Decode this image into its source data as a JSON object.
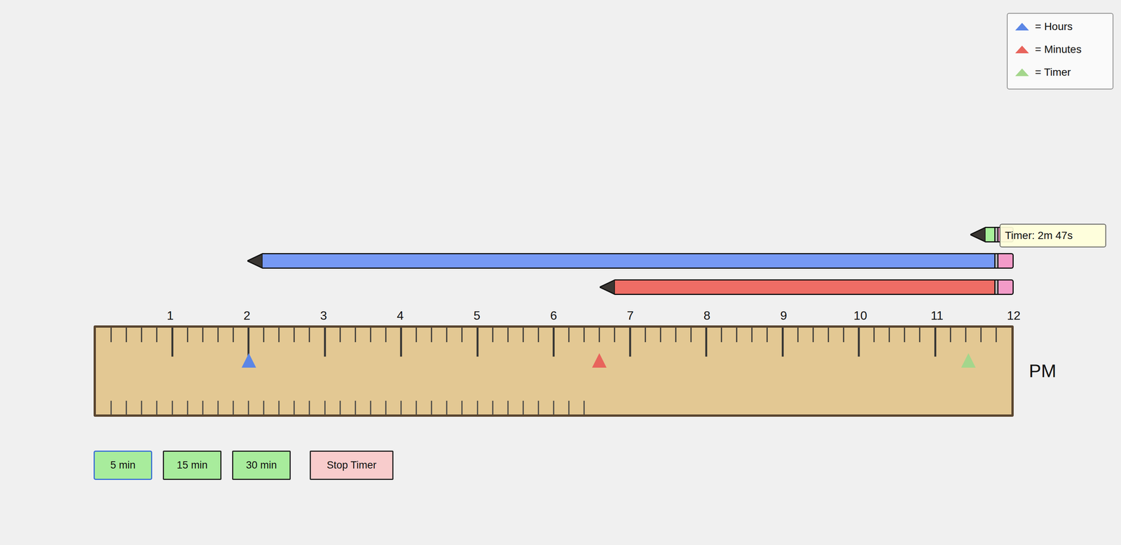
{
  "legend": [
    {
      "label": "= Hours",
      "color": "#5b86e6"
    },
    {
      "label": "= Minutes",
      "color": "#e8645c"
    },
    {
      "label": "= Timer",
      "color": "#a4d68c"
    }
  ],
  "pencils": [
    {
      "level": 0.953,
      "color": "#a8f09a",
      "tooltip": "Timer: 2m 47s"
    },
    {
      "level": 0.167,
      "color": "#7699f4"
    },
    {
      "level": 0.55,
      "color": "#ee6d65"
    }
  ],
  "ruler": {
    "labels": [
      "1",
      "2",
      "3",
      "4",
      "5",
      "6",
      "7",
      "8",
      "9",
      "10",
      "11",
      "12"
    ],
    "period": "PM",
    "filled_ticks": 32,
    "markers": [
      {
        "level": 0.167,
        "color": "#5b86e6"
      },
      {
        "level": 0.55,
        "color": "#e8645c"
      },
      {
        "level": 0.953,
        "color": "#a4d68c"
      }
    ]
  },
  "buttons": [
    {
      "label": "5 min",
      "selected": true,
      "kind": "preset"
    },
    {
      "label": "15 min",
      "selected": false,
      "kind": "preset"
    },
    {
      "label": "30 min",
      "selected": false,
      "kind": "preset"
    },
    {
      "label": "Stop Timer",
      "selected": false,
      "kind": "stop"
    }
  ]
}
